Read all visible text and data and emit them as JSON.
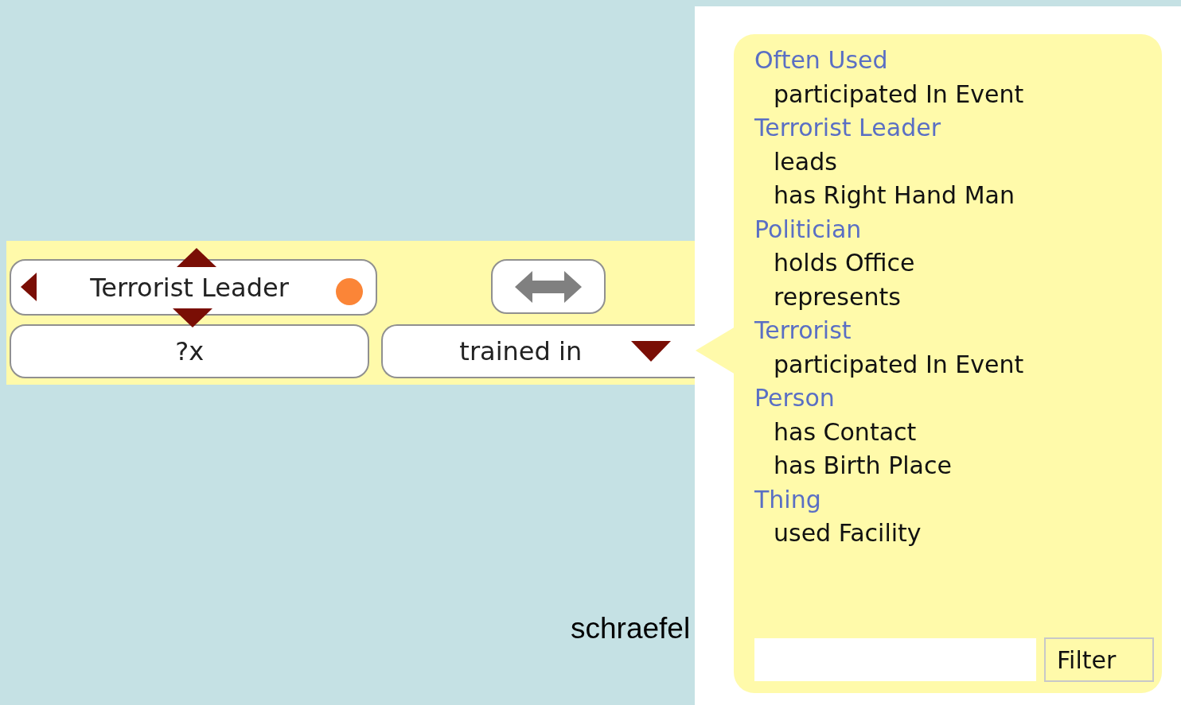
{
  "query_bar": {
    "subject": {
      "label": "Terrorist Leader",
      "color": "#fb8537"
    },
    "object": {
      "label": "?x"
    },
    "predicate": {
      "label": "trained in"
    }
  },
  "property_menu": {
    "groups": [
      {
        "heading": "Often Used",
        "items": [
          "participated In Event"
        ]
      },
      {
        "heading": "Terrorist Leader",
        "items": [
          "leads",
          "has Right Hand Man"
        ]
      },
      {
        "heading": "Politician",
        "items": [
          "holds Office",
          "represents"
        ]
      },
      {
        "heading": "Terrorist",
        "items": [
          "participated In Event"
        ]
      },
      {
        "heading": "Person",
        "items": [
          "has Contact",
          "has Birth Place"
        ]
      },
      {
        "heading": "Thing",
        "items": [
          "used Facility"
        ]
      }
    ],
    "filter_button": "Filter"
  },
  "caption": "schraefel"
}
